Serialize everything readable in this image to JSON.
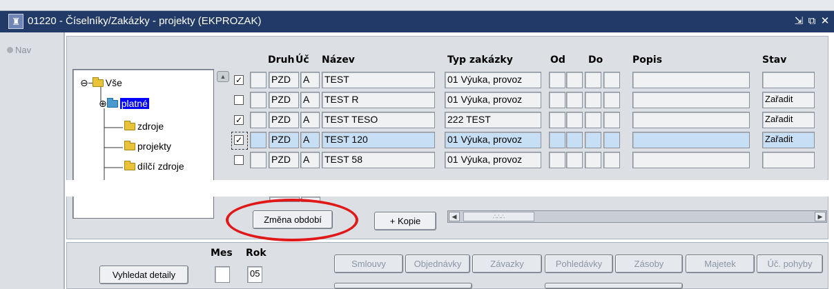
{
  "window": {
    "title": "01220 - Číselníky/Zakázky - projekty (EKPROZAK)",
    "buttons": [
      "minimize-icon",
      "restore-icon",
      "close-icon"
    ]
  },
  "nav": {
    "label": "Nav"
  },
  "tree": {
    "root": "Vše",
    "selected": "platné",
    "children": [
      "zdroje",
      "projekty",
      "dílčí zdroje"
    ]
  },
  "table": {
    "headers": {
      "druh": "Druh",
      "uc": "Úč",
      "nazev": "Název",
      "typ": "Typ zakázky",
      "od": "Od",
      "do": "Do",
      "popis": "Popis",
      "stav": "Stav"
    },
    "rows": [
      {
        "checked": true,
        "druh": "PZD",
        "uc": "A",
        "nazev": "TEST",
        "typ": "01 Výuka, provoz",
        "stav": ""
      },
      {
        "checked": false,
        "druh": "PZD",
        "uc": "A",
        "nazev": "TEST R",
        "typ": "01 Výuka, provoz",
        "stav": "Zařadit"
      },
      {
        "checked": true,
        "druh": "PZD",
        "uc": "A",
        "nazev": "TEST TESO",
        "typ": "222 TEST",
        "stav": "Zařadit"
      },
      {
        "checked": true,
        "druh": "PZD",
        "uc": "A",
        "nazev": "TEST 120",
        "typ": "01 Výuka, provoz",
        "stav": "Zařadit",
        "current": true
      },
      {
        "checked": false,
        "druh": "PZD",
        "uc": "A",
        "nazev": "TEST 58",
        "typ": "01 Výuka, provoz",
        "stav": ""
      }
    ]
  },
  "buttons": {
    "zmena_obdobi": "Změna období",
    "kopie": "+ Kopie",
    "vyhledat_detaily": "Vyhledat detaily"
  },
  "filters": {
    "mes_label": "Mes",
    "rok_label": "Rok",
    "mes_value": "",
    "rok_value": "05"
  },
  "detail_buttons": [
    "Smlouvy",
    "Objednávky",
    "Závazky",
    "Pohledávky",
    "Zásoby",
    "Majetek",
    "Úč. pohyby"
  ],
  "colors": {
    "titlebar": "#223a68",
    "panel": "#dcdfe4",
    "highlight": "#c6dff5",
    "selection": "#0000ff",
    "annotation": "#e01818"
  }
}
